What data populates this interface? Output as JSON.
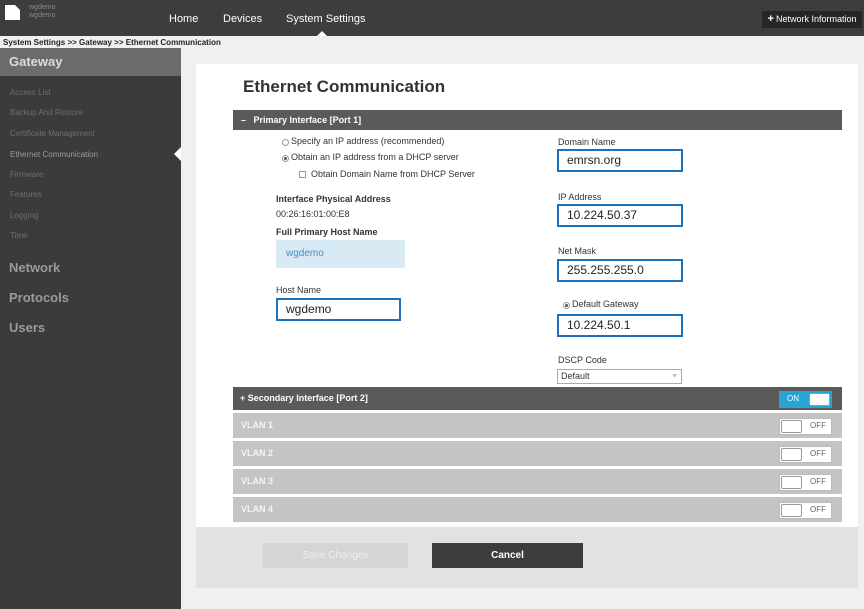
{
  "device": {
    "name": "wgdemo",
    "subname": "wgdemo"
  },
  "nav": {
    "home": "Home",
    "devices": "Devices",
    "system_settings": "System Settings",
    "network_info": "Network Information"
  },
  "breadcrumb": "System Settings >> Gateway >> Ethernet Communication",
  "sidebar": {
    "gateway": "Gateway",
    "items": [
      "Access List",
      "Backup And Restore",
      "Certificate Management",
      "Ethernet Communication",
      "Firmware",
      "Features",
      "Logging",
      "Time"
    ],
    "network": "Network",
    "protocols": "Protocols",
    "users": "Users"
  },
  "page": {
    "title": "Ethernet Communication"
  },
  "primary": {
    "header": "Primary Interface [Port 1]",
    "collapse_icon": "–",
    "radio_specify": "Specify an IP address (recommended)",
    "radio_dhcp": "Obtain an IP address from a DHCP server",
    "selected": "dhcp",
    "chk_domain": "Obtain Domain Name from DHCP Server",
    "phys_label": "Interface Physical Address",
    "phys_value": "00:26:16:01:00:E8",
    "fullhost_label": "Full Primary Host Name",
    "fullhost_value": "wgdemo",
    "hostname_label": "Host Name",
    "hostname_value": "wgdemo",
    "domain_label": "Domain Name",
    "domain_value": "emrsn.org",
    "ip_label": "IP Address",
    "ip_value": "10.224.50.37",
    "mask_label": "Net Mask",
    "mask_value": "255.255.255.0",
    "gw_label": "Default Gateway",
    "gw_value": "10.224.50.1",
    "dscp_label": "DSCP Code",
    "dscp_value": "Default"
  },
  "secondary": {
    "header": "Secondary Interface [Port 2]",
    "expand_icon": "+",
    "toggle": "ON"
  },
  "vlans": [
    {
      "label": "VLAN 1",
      "toggle": "OFF"
    },
    {
      "label": "VLAN 2",
      "toggle": "OFF"
    },
    {
      "label": "VLAN 3",
      "toggle": "OFF"
    },
    {
      "label": "VLAN 4",
      "toggle": "OFF"
    }
  ],
  "actions": {
    "save": "Save Changes",
    "cancel": "Cancel"
  },
  "colors": {
    "topbar": "#3d3d3d",
    "sidebar": "#3b3b3b",
    "accent": "#1c70c0",
    "toggle_on": "#29a3d6"
  }
}
